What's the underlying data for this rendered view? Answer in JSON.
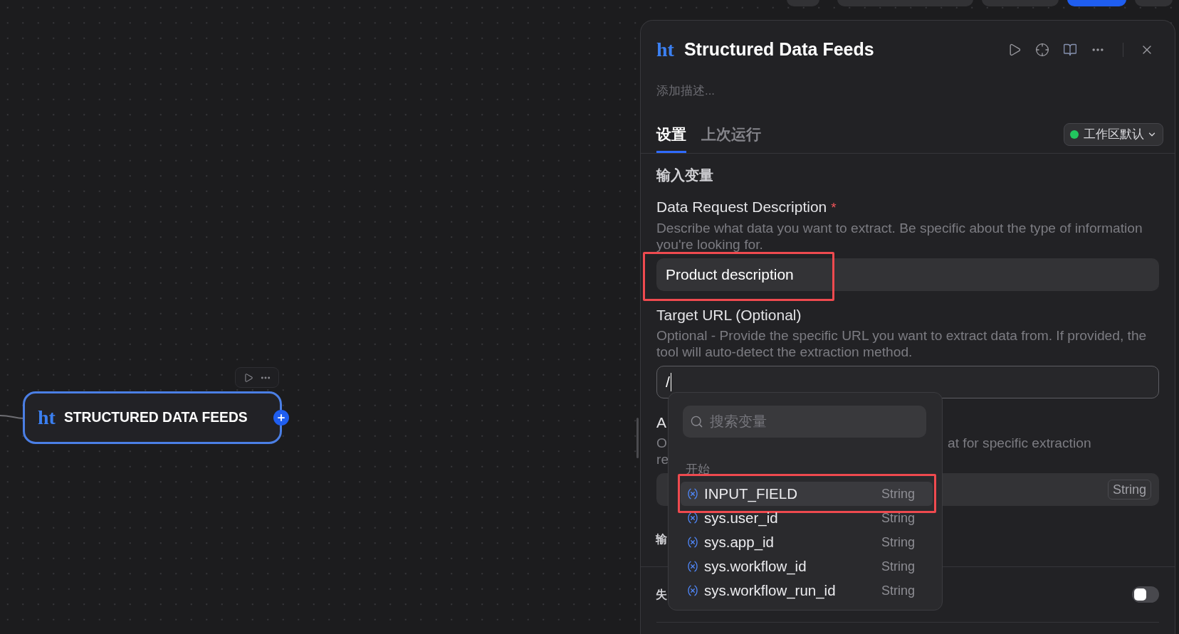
{
  "top_toolbar": [
    {
      "kind": "default"
    },
    {
      "kind": "default"
    },
    {
      "kind": "default"
    },
    {
      "kind": "primary"
    },
    {
      "kind": "default"
    }
  ],
  "node": {
    "logo": "ht",
    "title": "STRUCTURED DATA FEEDS",
    "selected": true
  },
  "panel": {
    "logo": "ht",
    "title": "Structured Data Feeds",
    "description": {
      "placeholder": "添加描述..."
    },
    "tabs": [
      {
        "label": "设置",
        "selected": true
      },
      {
        "label": "上次运行",
        "selected": false
      }
    ],
    "workspace_selector": {
      "label": "工作区默认"
    },
    "input_section": {
      "heading": "输入变量",
      "fields": [
        {
          "label": "Data Request Description",
          "required_mark": "*",
          "description": "Describe what data you want to extract. Be specific about the type of information you're looking for.",
          "value": "Product description",
          "focused": false,
          "highlighted": true
        },
        {
          "label": "Target URL (Optional)",
          "description": "Optional - Provide the specific URL you want to extract data from. If provided, the tool will auto-detect the extraction method.",
          "value": "/",
          "focused": true,
          "highlighted": false
        },
        {
          "label": "A",
          "description_left_lines": [
            "O",
            "re"
          ],
          "description_right": "at for specific extraction",
          "type_badge": "String",
          "focused": false,
          "highlighted": false
        }
      ]
    },
    "output_section": {
      "heading": "输"
    },
    "retry": {
      "label": "失",
      "on": false
    }
  },
  "variable_menu": {
    "search_placeholder": "搜索变量",
    "group": "开始",
    "items": [
      {
        "name": "INPUT_FIELD",
        "type": "String",
        "selected": true,
        "highlighted": true
      },
      {
        "name": "sys.user_id",
        "type": "String",
        "selected": false,
        "highlighted": false
      },
      {
        "name": "sys.app_id",
        "type": "String",
        "selected": false,
        "highlighted": false
      },
      {
        "name": "sys.workflow_id",
        "type": "String",
        "selected": false,
        "highlighted": false
      },
      {
        "name": "sys.workflow_run_id",
        "type": "String",
        "selected": false,
        "highlighted": false
      }
    ]
  }
}
